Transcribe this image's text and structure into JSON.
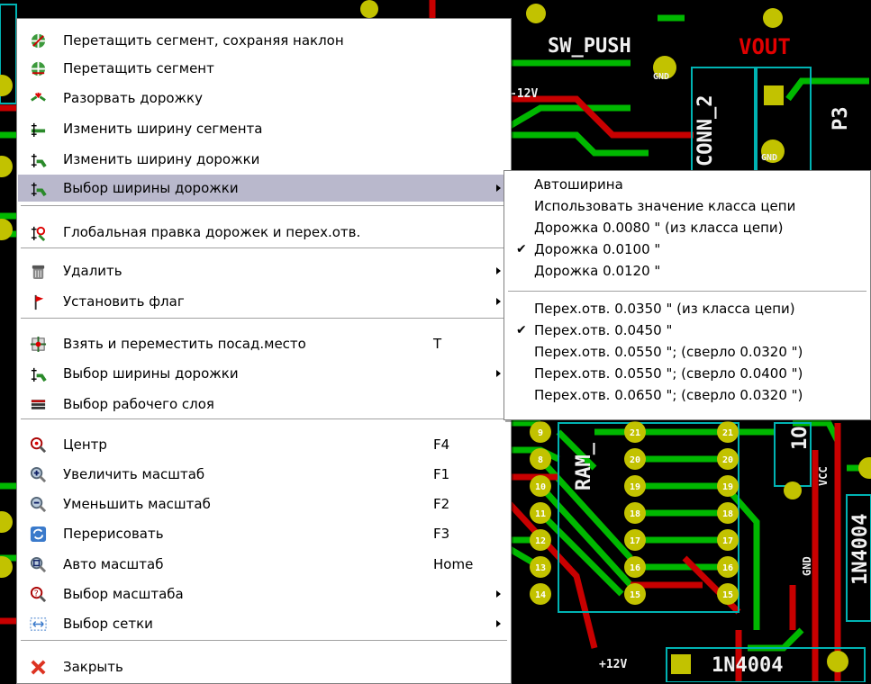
{
  "pcb": {
    "labels": {
      "sw_push": "SW_PUSH",
      "vout": "VOUT",
      "conn2": "CONN_2",
      "p3": "P3",
      "v12_top": "-12V",
      "gnd": "GND",
      "ram": "RAM_",
      "vcc": "VCC",
      "diode": "1N4004",
      "v12_bottom": "+12V",
      "r": "1O"
    },
    "pads_left": [
      "9",
      "8",
      "10",
      "11",
      "12",
      "13",
      "14"
    ],
    "pads_mid": [
      "21",
      "20",
      "19",
      "18",
      "17",
      "16",
      "15"
    ],
    "pads_right": [
      "21",
      "20",
      "19",
      "18",
      "17",
      "16",
      "15"
    ],
    "colors": {
      "track_green": "#00cc00",
      "track_red": "#cc0000",
      "pad": "#c2c200",
      "outline": "#00b3b3"
    }
  },
  "main_menu": {
    "items": [
      {
        "label": "Перетащить сегмент, сохраняя наклон",
        "icon": "drag-segment-keep-slope-icon",
        "shortcut": "",
        "submenu": false
      },
      {
        "label": "Перетащить сегмент",
        "icon": "drag-segment-icon",
        "shortcut": "",
        "submenu": false
      },
      {
        "label": "Разорвать дорожку",
        "icon": "break-track-icon",
        "shortcut": "",
        "submenu": false
      },
      {
        "label": "Изменить ширину сегмента",
        "icon": "segment-width-icon",
        "shortcut": "",
        "submenu": false
      },
      {
        "label": "Изменить ширину дорожки",
        "icon": "track-width-icon",
        "shortcut": "",
        "submenu": false
      },
      {
        "label": "Выбор ширины дорожки",
        "icon": "select-track-width-icon",
        "shortcut": "",
        "submenu": true
      },
      {
        "label": "Глобальная правка дорожек и перех.отв.",
        "icon": "global-edit-tracks-icon",
        "shortcut": "",
        "submenu": false
      },
      {
        "label": "Удалить",
        "icon": "trash-icon",
        "shortcut": "",
        "submenu": true
      },
      {
        "label": "Установить флаг",
        "icon": "flag-icon",
        "shortcut": "",
        "submenu": true
      },
      {
        "label": "Взять и переместить посад.место",
        "icon": "move-footprint-icon",
        "shortcut": "T",
        "submenu": false
      },
      {
        "label": "Выбор ширины дорожки",
        "icon": "select-track-width-icon",
        "shortcut": "",
        "submenu": true
      },
      {
        "label": "Выбор рабочего слоя",
        "icon": "layers-icon",
        "shortcut": "",
        "submenu": false
      },
      {
        "label": "Центр",
        "icon": "zoom-center-icon",
        "shortcut": "F4",
        "submenu": false
      },
      {
        "label": "Увеличить масштаб",
        "icon": "zoom-in-icon",
        "shortcut": "F1",
        "submenu": false
      },
      {
        "label": "Уменьшить масштаб",
        "icon": "zoom-out-icon",
        "shortcut": "F2",
        "submenu": false
      },
      {
        "label": "Перерисовать",
        "icon": "redraw-icon",
        "shortcut": "F3",
        "submenu": false
      },
      {
        "label": "Авто масштаб",
        "icon": "zoom-auto-icon",
        "shortcut": "Home",
        "submenu": false
      },
      {
        "label": "Выбор масштаба",
        "icon": "zoom-select-icon",
        "shortcut": "",
        "submenu": true
      },
      {
        "label": "Выбор сетки",
        "icon": "grid-icon",
        "shortcut": "",
        "submenu": true
      },
      {
        "label": "Закрыть",
        "icon": "close-icon",
        "shortcut": "",
        "submenu": false
      }
    ]
  },
  "sub_menu": {
    "items": [
      {
        "label": "Автоширина",
        "checked": false
      },
      {
        "label": "Использовать значение класса цепи",
        "checked": false
      },
      {
        "label": "Дорожка 0.0080 \" (из класса цепи)",
        "checked": false
      },
      {
        "label": "Дорожка 0.0100 \"",
        "checked": true
      },
      {
        "label": "Дорожка 0.0120 \"",
        "checked": false
      },
      {
        "label": "Перех.отв. 0.0350 \" (из класса цепи)",
        "checked": false
      },
      {
        "label": "Перех.отв. 0.0450 \"",
        "checked": true
      },
      {
        "label": "Перех.отв. 0.0550 \"; (сверло 0.0320 \")",
        "checked": false
      },
      {
        "label": "Перех.отв. 0.0550 \"; (сверло 0.0400 \")",
        "checked": false
      },
      {
        "label": "Перех.отв. 0.0650 \"; (сверло 0.0320 \")",
        "checked": false
      }
    ]
  }
}
